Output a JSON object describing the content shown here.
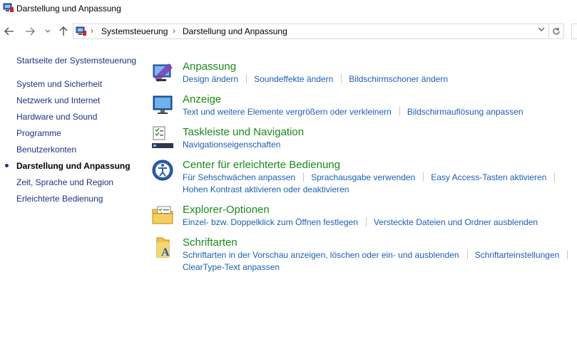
{
  "window": {
    "title": "Darstellung und Anpassung"
  },
  "nav": {
    "back_icon": "arrow-left-icon",
    "forward_icon": "arrow-right-icon",
    "up_icon": "arrow-up-icon",
    "refresh_icon": "refresh-icon"
  },
  "address": {
    "crumbs": [
      "Systemsteuerung",
      "Darstellung und Anpassung"
    ]
  },
  "sidebar": {
    "home": "Startseite der Systemsteuerung",
    "items": [
      {
        "label": "System und Sicherheit"
      },
      {
        "label": "Netzwerk und Internet"
      },
      {
        "label": "Hardware und Sound"
      },
      {
        "label": "Programme"
      },
      {
        "label": "Benutzerkonten"
      },
      {
        "label": "Darstellung und Anpassung",
        "active": true
      },
      {
        "label": "Zeit, Sprache und Region"
      },
      {
        "label": "Erleichterte Bedienung"
      }
    ]
  },
  "categories": [
    {
      "title": "Anpassung",
      "icon": "personalization-icon",
      "lines": [
        [
          "Design ändern",
          "Soundeffekte ändern",
          "Bildschirmschoner ändern"
        ]
      ]
    },
    {
      "title": "Anzeige",
      "icon": "display-monitor-icon",
      "lines": [
        [
          "Text und weitere Elemente vergrößern oder verkleinern",
          "Bildschirmauflösung anpassen"
        ]
      ]
    },
    {
      "title": "Taskleiste und Navigation",
      "icon": "taskbar-icon",
      "lines": [
        [
          "Navigationseigenschaften"
        ]
      ]
    },
    {
      "title": "Center für erleichterte Bedienung",
      "icon": "ease-of-access-icon",
      "lines": [
        [
          "Für Sehschwächen anpassen",
          "Sprachausgabe verwenden",
          "Easy Access-Tasten aktivieren",
          ""
        ],
        [
          "Hohen Kontrast aktivieren oder deaktivieren"
        ]
      ]
    },
    {
      "title": "Explorer-Optionen",
      "icon": "folder-options-icon",
      "lines": [
        [
          "Einzel- bzw. Doppelklick zum Öffnen festlegen",
          "Versteckte Dateien und Ordner ausblenden"
        ]
      ]
    },
    {
      "title": "Schriftarten",
      "icon": "fonts-folder-icon",
      "lines": [
        [
          "Schriftarten in der Vorschau anzeigen, löschen oder ein- und ausblenden",
          "Schriftarteinstellungen",
          ""
        ],
        [
          "ClearType-Text anpassen"
        ]
      ]
    }
  ],
  "colors": {
    "category_title": "#1a8a1a",
    "link": "#1a5fb4",
    "sidebar_link": "#1e3287"
  }
}
